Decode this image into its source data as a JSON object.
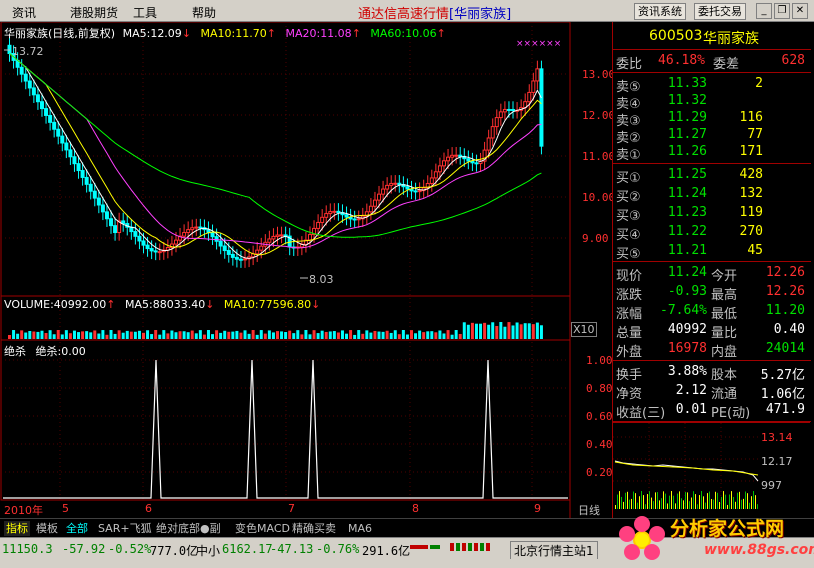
{
  "menu": {
    "items": [
      "资讯",
      "港股期货",
      "工具",
      "帮助"
    ],
    "app_title": "通达信高速行情",
    "stock_in_title": "[华丽家族]",
    "btn_news": "资讯系统",
    "btn_trade": "委托交易"
  },
  "main_chart": {
    "stock_name": "华丽家族(日线,前复权)",
    "ma5": "MA5:12.09",
    "ma10": "MA10:11.70",
    "ma20": "MA20:11.08",
    "ma60": "MA60:10.06",
    "high_mark": "13.72",
    "low_mark": "8.03",
    "y_ticks": [
      "13.00",
      "12.00",
      "11.00",
      "10.00",
      "9.00"
    ],
    "colors": {
      "ma5": "#ffffff",
      "ma10": "#ffff00",
      "ma20": "#ff40ff",
      "ma60": "#00ff00",
      "up": "#ff3030",
      "down": "#00ffff"
    }
  },
  "volume_panel": {
    "title": "VOLUME:40992.00",
    "ma5": "MA5:88033.40",
    "ma10": "MA10:77596.80",
    "scale": "X10"
  },
  "indicator_panel": {
    "title": "绝杀",
    "value": "绝杀:0.00",
    "y_ticks": [
      "1.00",
      "0.80",
      "0.60",
      "0.40",
      "0.20"
    ]
  },
  "x_axis": {
    "labels": [
      "2010年",
      "5",
      "6",
      "7",
      "8",
      "9"
    ],
    "period": "日线"
  },
  "quote": {
    "code": "600503",
    "name": "华丽家族",
    "weibi_label": "委比",
    "weibi": "46.18%",
    "weicha_label": "委差",
    "weicha": "628",
    "sell": [
      {
        "label": "卖⑤",
        "price": "11.33",
        "vol": "2"
      },
      {
        "label": "卖④",
        "price": "11.32",
        "vol": ""
      },
      {
        "label": "卖③",
        "price": "11.29",
        "vol": "116"
      },
      {
        "label": "卖②",
        "price": "11.27",
        "vol": "77"
      },
      {
        "label": "卖①",
        "price": "11.26",
        "vol": "171"
      }
    ],
    "buy": [
      {
        "label": "买①",
        "price": "11.25",
        "vol": "428"
      },
      {
        "label": "买②",
        "price": "11.24",
        "vol": "132"
      },
      {
        "label": "买③",
        "price": "11.23",
        "vol": "119"
      },
      {
        "label": "买④",
        "price": "11.22",
        "vol": "270"
      },
      {
        "label": "买⑤",
        "price": "11.21",
        "vol": "45"
      }
    ],
    "stats": [
      {
        "l1": "现价",
        "v1": "11.24",
        "c1": "g",
        "l2": "今开",
        "v2": "12.26",
        "c2": "r"
      },
      {
        "l1": "涨跌",
        "v1": "-0.93",
        "c1": "g",
        "l2": "最高",
        "v2": "12.26",
        "c2": "r"
      },
      {
        "l1": "涨幅",
        "v1": "-7.64%",
        "c1": "g",
        "l2": "最低",
        "v2": "11.20",
        "c2": "g"
      },
      {
        "l1": "总量",
        "v1": "40992",
        "c1": "w",
        "l2": "量比",
        "v2": "0.40",
        "c2": "w"
      },
      {
        "l1": "外盘",
        "v1": "16978",
        "c1": "r",
        "l2": "内盘",
        "v2": "24014",
        "c2": "g"
      }
    ],
    "stats2": [
      {
        "l1": "换手",
        "v1": "3.88%",
        "l2": "股本",
        "v2": "5.27亿"
      },
      {
        "l1": "净资",
        "v1": "2.12",
        "l2": "流通",
        "v2": "1.06亿"
      },
      {
        "l1": "收益(三)",
        "v1": "0.01",
        "l2": "PE(动)",
        "v2": "471.9"
      }
    ]
  },
  "mini_chart": {
    "top": "13.14",
    "mid": "12.17",
    "low": "997"
  },
  "tabs": [
    "指标",
    "模板",
    "全部",
    "SAR+飞狐",
    "绝对底部●副",
    "变色MACD",
    "精确买卖",
    "MA6"
  ],
  "status": {
    "sh_index": "11150.3",
    "sh_change": "-57.92",
    "sh_pct": "-0.52%",
    "sh_amount": "777.0亿",
    "zx_label": "中小",
    "zx_index": "6162.17",
    "zx_change": "-47.13",
    "zx_pct": "-0.76%",
    "zx_amount": "291.6亿",
    "server": "北京行情主站1"
  },
  "watermark": {
    "site": "分析家公式网",
    "url": "www.88gs.com"
  }
}
